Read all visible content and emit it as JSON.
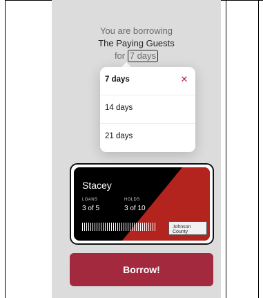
{
  "header": {
    "intro": "You are borrowing",
    "book_title": "The Paying Guests",
    "for_prefix": "for",
    "selected_period": "7 days"
  },
  "period_menu": {
    "options": [
      {
        "label": "7 days",
        "selected": true
      },
      {
        "label": "14 days",
        "selected": false
      },
      {
        "label": "21 days",
        "selected": false
      }
    ]
  },
  "library_card": {
    "name": "Stacey",
    "loans_label": "LOANS",
    "loans_value": "3 of 5",
    "holds_label": "HOLDS",
    "holds_value": "3 of 10",
    "logo_text": "Johnson County",
    "icon": "barcode-icon"
  },
  "action": {
    "borrow_label": "Borrow!"
  },
  "colors": {
    "accent": "#a3293f",
    "card_red": "#b3241f",
    "close_icon": "#c41e3a"
  }
}
